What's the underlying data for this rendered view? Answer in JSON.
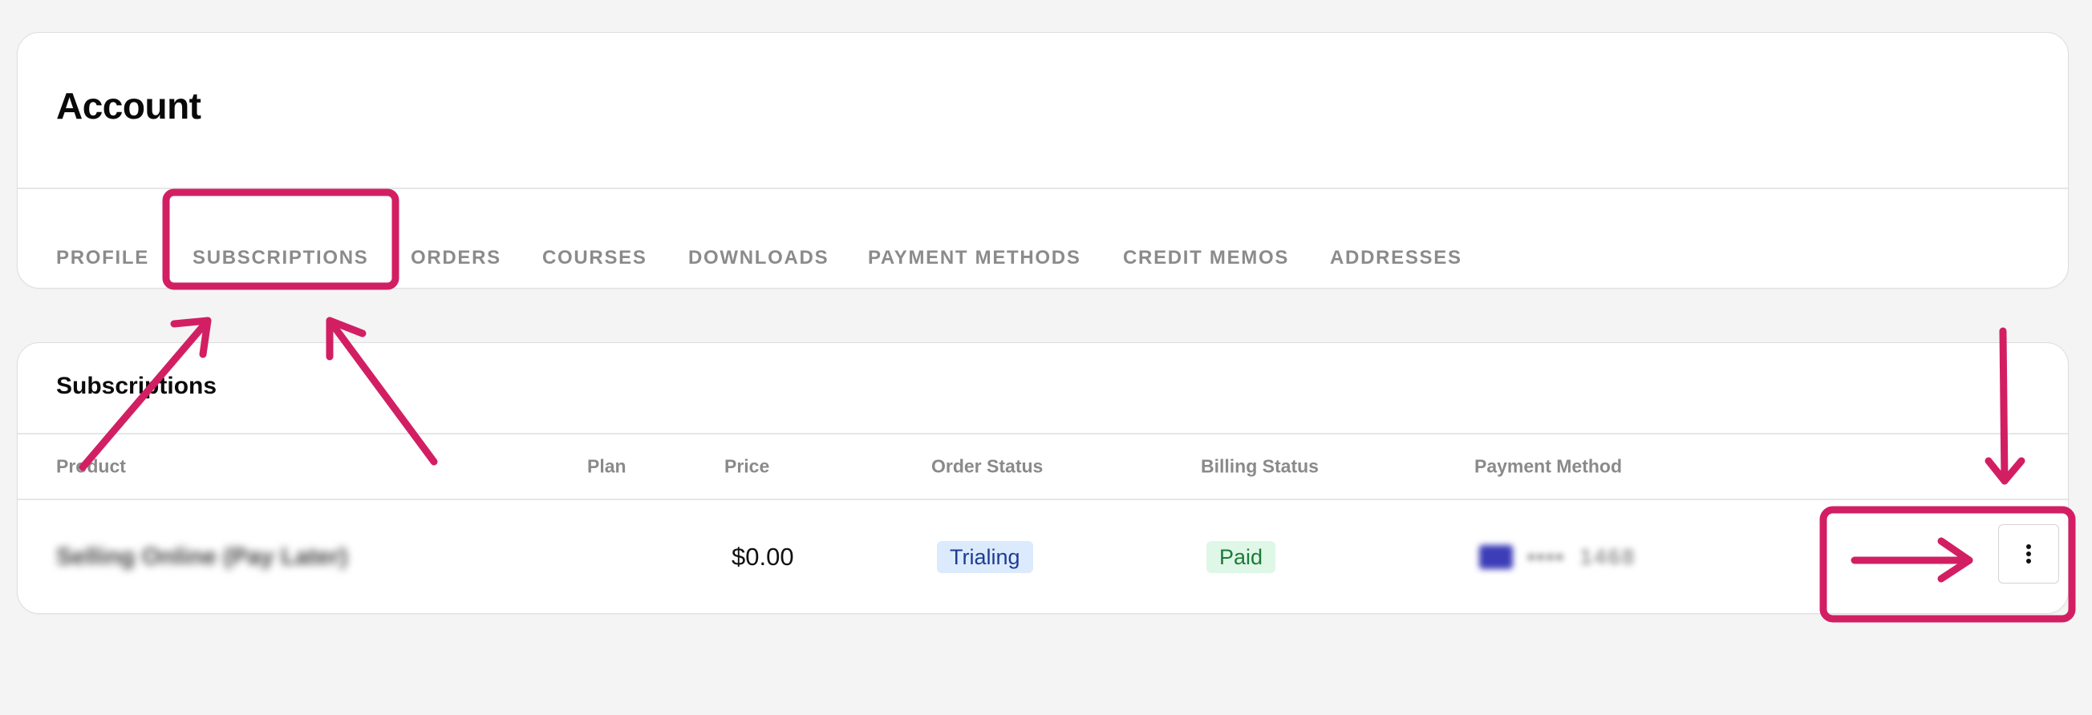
{
  "account": {
    "title": "Account",
    "tabs": [
      {
        "label": "PROFILE"
      },
      {
        "label": "SUBSCRIPTIONS"
      },
      {
        "label": "ORDERS"
      },
      {
        "label": "COURSES"
      },
      {
        "label": "DOWNLOADS"
      },
      {
        "label": "PAYMENT METHODS"
      },
      {
        "label": "CREDIT MEMOS"
      },
      {
        "label": "ADDRESSES"
      }
    ]
  },
  "subscriptions": {
    "title": "Subscriptions",
    "columns": [
      {
        "label": "Product"
      },
      {
        "label": "Plan"
      },
      {
        "label": "Price"
      },
      {
        "label": "Order Status"
      },
      {
        "label": "Billing Status"
      },
      {
        "label": "Payment Method"
      }
    ],
    "rows": [
      {
        "product": "Selling Online (Pay Later)",
        "plan": "",
        "price": "$0.00",
        "order_status": "Trialing",
        "billing_status": "Paid",
        "payment_method": {
          "brand_icon": "card-icon",
          "masked": "••••",
          "last4": "1468"
        },
        "actions_icon": "more-vertical-icon"
      }
    ]
  },
  "colors": {
    "annotation": "#d21f63",
    "trialing_bg": "#dceafe",
    "trialing_text": "#1c3d91",
    "paid_bg": "#dff7e6",
    "paid_text": "#1d7a39",
    "card_icon": "#3c3db7"
  }
}
